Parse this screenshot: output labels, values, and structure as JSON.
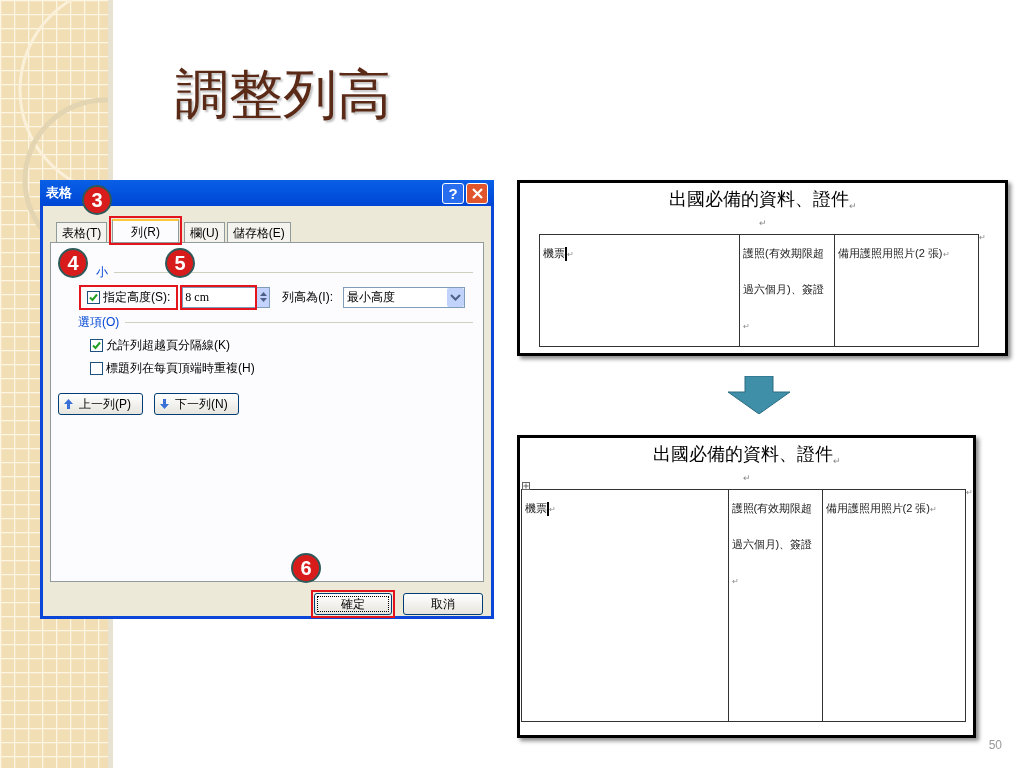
{
  "slide": {
    "title": "調整列高",
    "page_number": "50"
  },
  "dialog": {
    "title": "表格",
    "help": "?",
    "tabs": [
      {
        "label": "表格(T)",
        "selected": false
      },
      {
        "label": "列(R)",
        "selected": true
      },
      {
        "label": "欄(U)",
        "selected": false
      },
      {
        "label": "儲存格(E)",
        "selected": false
      }
    ],
    "size_group": {
      "label": "小",
      "specify_height": {
        "label": "指定高度(S):",
        "checked": true
      },
      "height_value": "8 cm",
      "row_height_label": "列高為(I):",
      "row_height_mode": "最小高度"
    },
    "options_group": {
      "label": "選項(O)",
      "options": [
        {
          "label": "允許列超越頁分隔線(K)",
          "checked": true
        },
        {
          "label": "標題列在每頁頂端時重複(H)",
          "checked": false
        }
      ]
    },
    "nav_buttons": [
      {
        "label": "上一列(P)",
        "kind": "up"
      },
      {
        "label": "下一列(N)",
        "kind": "down"
      }
    ],
    "footer_buttons": [
      {
        "label": "確定",
        "focused": true
      },
      {
        "label": "取消",
        "focused": false
      }
    ]
  },
  "callouts": [
    "3",
    "4",
    "5",
    "6"
  ],
  "documents": [
    {
      "heading": "出國必備的資料、證件",
      "mark": "↵",
      "move_handle": false,
      "cells": [
        {
          "text": "機票",
          "cursor": true
        },
        {
          "text": "護照(有效期限超過六個月)、簽證",
          "cursor": false
        },
        {
          "text": "備用護照用照片(2 張)",
          "cursor": false
        }
      ]
    },
    {
      "heading": "出國必備的資料、證件",
      "mark": "↵",
      "move_handle": true,
      "cells": [
        {
          "text": "機票",
          "cursor": true
        },
        {
          "text": "護照(有效期限超過六個月)、簽證",
          "cursor": false
        },
        {
          "text": "備用護照用照片(2 張)",
          "cursor": false
        }
      ]
    }
  ]
}
